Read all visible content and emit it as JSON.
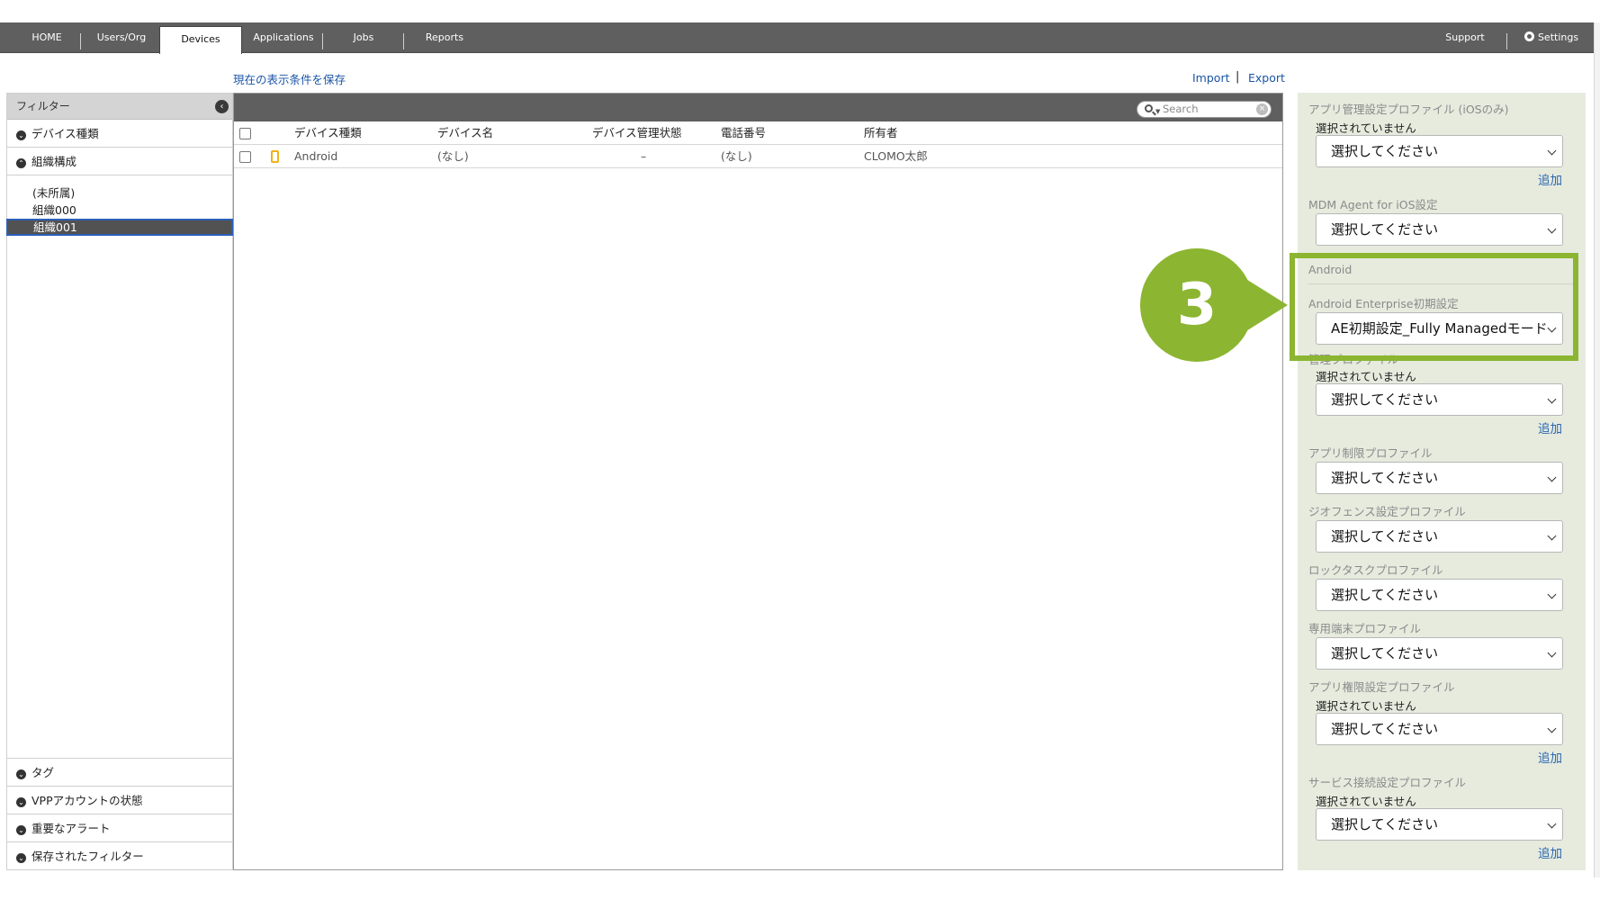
{
  "nav": {
    "tabs": [
      "HOME",
      "Users/Org",
      "Devices",
      "Applications",
      "Jobs",
      "Reports"
    ],
    "support": "Support",
    "settings": "Settings"
  },
  "toolbar": {
    "save_view": "現在の表示条件を保存",
    "import": "Import",
    "separator": "|",
    "export": "Export"
  },
  "sidebar": {
    "title": "フィルター",
    "sections_top": [
      "デバイス種類",
      "組織構成"
    ],
    "orgs": [
      "(未所属)",
      "組織000",
      "組織001"
    ],
    "selected_org": "組織001",
    "sections_bottom": [
      "タグ",
      "VPPアカウントの状態",
      "重要なアラート",
      "保存されたフィルター"
    ]
  },
  "table": {
    "search_placeholder": "Search",
    "columns": [
      "デバイス種類",
      "デバイス名",
      "デバイス管理状態",
      "電話番号",
      "所有者"
    ],
    "rows": [
      {
        "type": "Android",
        "name": "(なし)",
        "status": "–",
        "phone": "(なし)",
        "owner": "CLOMO太郎"
      }
    ]
  },
  "panel": {
    "app_mgmt_label": "アプリ管理設定プロファイル (iOSのみ)",
    "not_selected": "選択されていません",
    "select_placeholder": "選択してください",
    "add": "追加",
    "mdm_agent_label": "MDM Agent for iOS設定",
    "android_header": "Android",
    "ae_label": "Android Enterprise初期設定",
    "ae_value": "AE初期設定_Fully Managedモード",
    "mgmt_profile_label": "管理プロファイル",
    "app_restrict_label": "アプリ制限プロファイル",
    "geofence_label": "ジオフェンス設定プロファイル",
    "locktask_label": "ロックタスクプロファイル",
    "dedicated_label": "専用端末プロファイル",
    "app_permission_label": "アプリ権限設定プロファイル",
    "service_conn_label": "サービス接続設定プロファイル"
  },
  "callout": {
    "number": "3",
    "color": "#8cb531"
  }
}
